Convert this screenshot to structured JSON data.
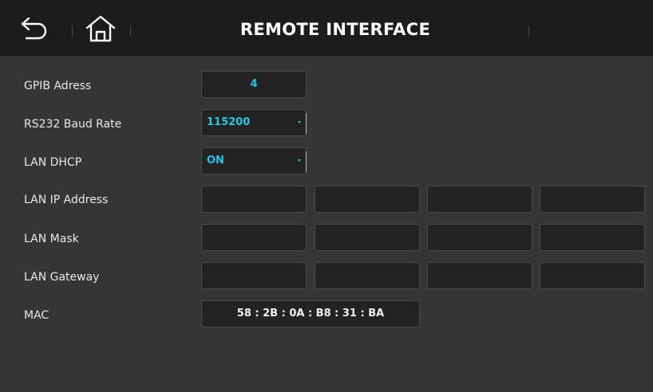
{
  "header": {
    "title": "REMOTE INTERFACE",
    "back_icon": "back-arrow-icon",
    "home_icon": "home-icon"
  },
  "rows": {
    "gpib": {
      "label": "GPIB Adress",
      "value": "4"
    },
    "baud": {
      "label": "RS232 Baud Rate",
      "value": "115200"
    },
    "dhcp": {
      "label": "LAN DHCP",
      "value": "ON"
    },
    "ip": {
      "label": "LAN IP Address",
      "octets": [
        "",
        "",
        "",
        ""
      ]
    },
    "mask": {
      "label": "LAN Mask",
      "octets": [
        "",
        "",
        "",
        ""
      ]
    },
    "gateway": {
      "label": "LAN Gateway",
      "octets": [
        "",
        "",
        "",
        ""
      ]
    },
    "mac": {
      "label": "MAC",
      "value": "58 : 2B : 0A : B8 : 31 : BA"
    }
  },
  "colors": {
    "background": "#353535",
    "topbar": "#1c1c1c",
    "accent": "#22c7e6",
    "field": "#232323",
    "field_border": "#4a4a4a"
  }
}
